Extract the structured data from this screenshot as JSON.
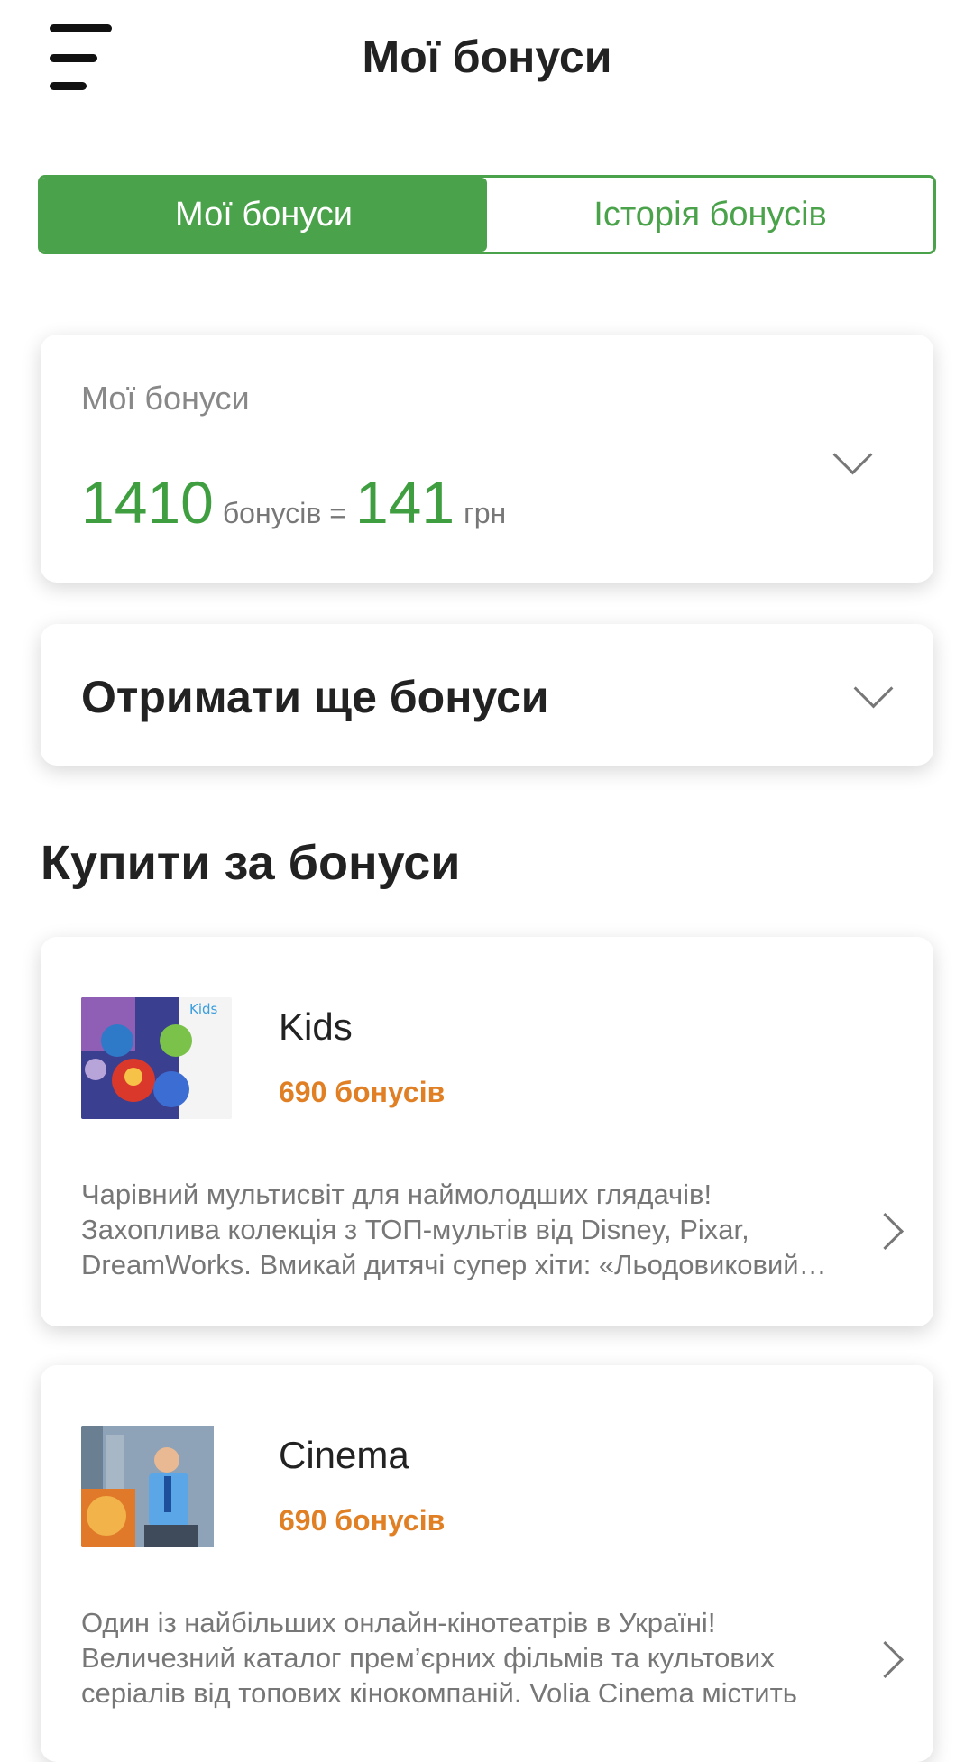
{
  "header": {
    "title": "Мої бонуси",
    "menu_icon": "hamburger-icon"
  },
  "tabs": [
    {
      "label": "Мої бонуси",
      "active": true
    },
    {
      "label": "Історія бонусів",
      "active": false
    }
  ],
  "balance": {
    "label": "Мої бонуси",
    "bonus_amount": "1410",
    "bonus_unit": "бонусів =",
    "money_amount": "141",
    "money_unit": "грн"
  },
  "earn_more": {
    "label": "Отримати ще бонуси"
  },
  "buy_section": {
    "title": "Купити за бонуси"
  },
  "products": [
    {
      "name": "Kids",
      "price": "690 бонусів",
      "description": "Чарівний мультисвіт для наймолодших глядачів! Захоплива колекція з ТОП-мультів від Disney, Pixar, DreamWorks. Вмикай дитячі супер хіти: «Льодовиковий період»",
      "thumb_logo": "Kids"
    },
    {
      "name": "Cinema",
      "price": "690 бонусів",
      "description": "Один із найбільших онлайн-кінотеатрів в Україні! Величезний каталог прем’єрних фільмів та культових серіалів від топових кінокомпаній. Volia Cinema містить"
    }
  ],
  "colors": {
    "accent_green": "#4aa24a",
    "price_orange": "#e07f24"
  }
}
